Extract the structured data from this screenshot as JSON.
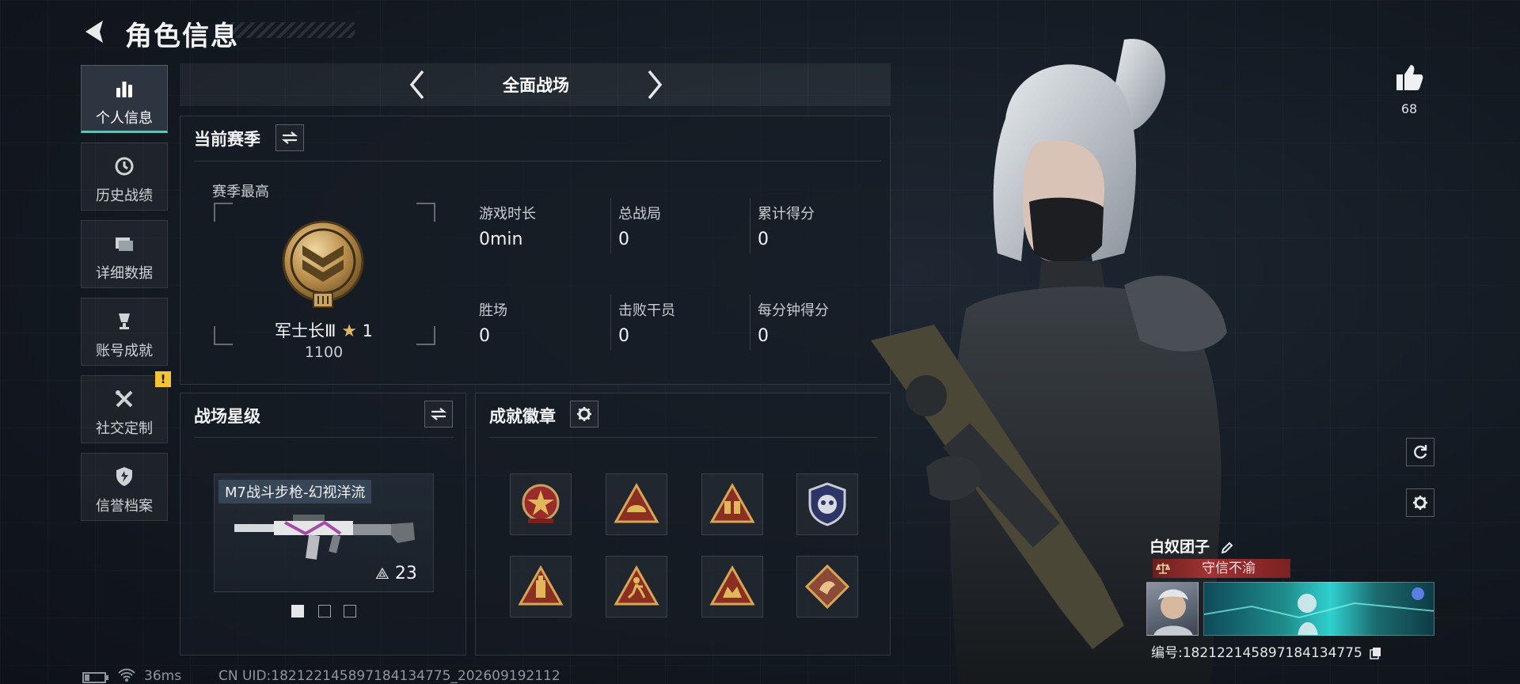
{
  "header": {
    "title": "角色信息"
  },
  "sidebar": {
    "items": [
      {
        "label": "个人信息",
        "icon": "bar-chart-icon",
        "active": true
      },
      {
        "label": "历史战绩",
        "icon": "clock-history-icon",
        "active": false
      },
      {
        "label": "详细数据",
        "icon": "folder-icon",
        "active": false
      },
      {
        "label": "账号成就",
        "icon": "trophy-icon",
        "active": false
      },
      {
        "label": "社交定制",
        "icon": "tools-icon",
        "active": false,
        "alert": "!"
      },
      {
        "label": "信誉档案",
        "icon": "shield-icon",
        "active": false
      }
    ]
  },
  "mode_selector": {
    "current": "全面战场"
  },
  "season": {
    "title": "当前赛季",
    "best_label": "赛季最高",
    "rank_name": "军士长Ⅲ",
    "rank_stars": "1",
    "rank_points": "1100",
    "stats": [
      {
        "label": "游戏时长",
        "value": "0min"
      },
      {
        "label": "总战局",
        "value": "0"
      },
      {
        "label": "累计得分",
        "value": "0"
      },
      {
        "label": "胜场",
        "value": "0"
      },
      {
        "label": "击败干员",
        "value": "0"
      },
      {
        "label": "每分钟得分",
        "value": "0"
      }
    ]
  },
  "battlefield_star": {
    "title": "战场星级",
    "weapon_name": "M7战斗步枪-幻视洋流",
    "weapon_stars": "23",
    "pager_count": 3,
    "pager_active": 0
  },
  "achievements": {
    "title": "成就徽章",
    "badges": [
      "star-medal-badge",
      "helmet-triangle-badge",
      "boots-triangle-badge",
      "skull-shield-badge",
      "bottle-triangle-badge",
      "runner-triangle-badge",
      "ammo-triangle-badge",
      "dragon-diamond-badge"
    ]
  },
  "hud": {
    "likes": "68"
  },
  "player": {
    "name": "白奴团子",
    "title_tag": "守信不渝",
    "id_text": "编号:1821221458971841347​75"
  },
  "footer": {
    "ping": "36ms",
    "uid": "CN UID:182122145897184134775_202609192112"
  },
  "colors": {
    "accent": "#36d8b7",
    "alert": "#f4c431",
    "tag_red": "#a03232",
    "gold": "#c8a063"
  }
}
